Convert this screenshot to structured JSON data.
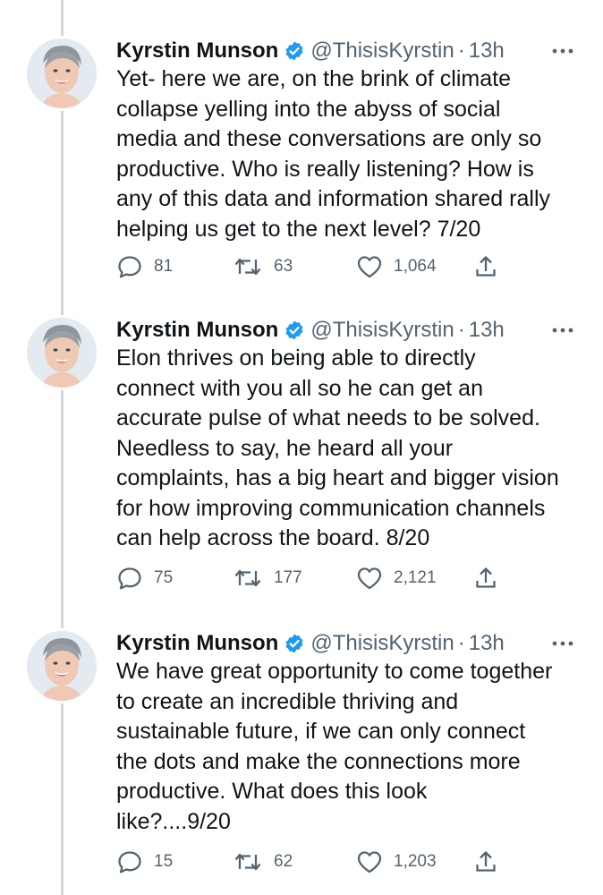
{
  "tweets": [
    {
      "name": "Kyrstin Munson",
      "handle": "@ThisisKyrstin",
      "separator": "·",
      "time": "13h",
      "text": "Yet- here we are, on the brink of climate\ncollapse yelling into the abyss of social\nmedia and these conversations are only so\nproductive. Who is really listening?  How is\nany of this data and information shared rally\nhelping us get to the next level? 7/20",
      "replies": "81",
      "retweets": "63",
      "likes": "1,064"
    },
    {
      "name": "Kyrstin Munson",
      "handle": "@ThisisKyrstin",
      "separator": "·",
      "time": "13h",
      "text": "Elon thrives on being able to directly\nconnect with you all so he can get an\naccurate pulse of what needs to be solved.\nNeedless to say, he heard all your\ncomplaints, has a big heart and bigger vision\nfor how improving communication channels\ncan help across the board. 8/20",
      "replies": "75",
      "retweets": "177",
      "likes": "2,121"
    },
    {
      "name": "Kyrstin Munson",
      "handle": "@ThisisKyrstin",
      "separator": "·",
      "time": "13h",
      "text": "We have great opportunity to come together\nto create an incredible thriving and\nsustainable future, if we can only connect\nthe dots and make the connections more\nproductive. What does this look\nlike?....9/20",
      "replies": "15",
      "retweets": "62",
      "likes": "1,203"
    }
  ],
  "colors": {
    "verified": "#1d9bf0",
    "muted": "#536471",
    "text": "#0f1419",
    "thread_line": "#cfd9de"
  },
  "icons": [
    "verified-badge-icon",
    "more-icon",
    "reply-icon",
    "retweet-icon",
    "like-icon",
    "share-icon"
  ]
}
